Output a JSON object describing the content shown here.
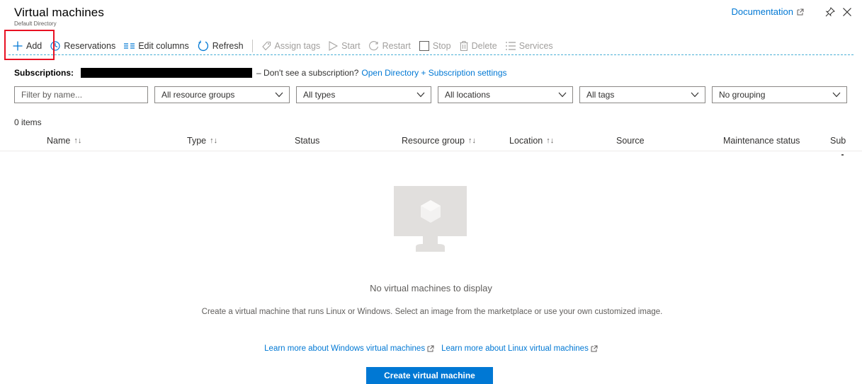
{
  "page": {
    "title": "Virtual machines",
    "subtitle": "Default Directory"
  },
  "top_right": {
    "documentation_label": "Documentation"
  },
  "toolbar": {
    "add": "Add",
    "reservations": "Reservations",
    "edit_columns": "Edit columns",
    "refresh": "Refresh",
    "assign_tags": "Assign tags",
    "start": "Start",
    "restart": "Restart",
    "stop": "Stop",
    "delete": "Delete",
    "services": "Services"
  },
  "subscriptions": {
    "label": "Subscriptions:",
    "text": "– Don't see a subscription?",
    "link": "Open Directory + Subscription settings"
  },
  "filters": {
    "name_placeholder": "Filter by name...",
    "resource_groups": "All resource groups",
    "types": "All types",
    "locations": "All locations",
    "tags": "All tags",
    "grouping": "No grouping"
  },
  "list": {
    "count": "0 items",
    "columns": {
      "name": "Name",
      "type": "Type",
      "status": "Status",
      "resource_group": "Resource group",
      "location": "Location",
      "source": "Source",
      "maintenance": "Maintenance status",
      "subscription": "Sub"
    },
    "sort_glyph": "↑↓"
  },
  "empty_state": {
    "title": "No virtual machines to display",
    "description": "Create a virtual machine that runs Linux or Windows. Select an image from the marketplace or use your own customized image.",
    "learn_windows": "Learn more about Windows virtual machines",
    "learn_linux": "Learn more about Linux virtual machines",
    "create_button": "Create virtual machine"
  },
  "colors": {
    "accent": "#0078d4",
    "highlight_box": "#e81123",
    "disabled_text": "#a19f9d"
  }
}
